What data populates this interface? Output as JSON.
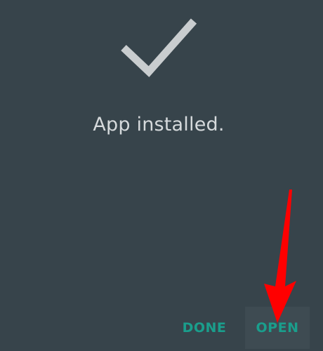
{
  "dialog": {
    "status_message": "App installed.",
    "done_label": "DONE",
    "open_label": "OPEN"
  },
  "icons": {
    "success": "checkmark-icon",
    "annotation": "red-arrow-icon"
  },
  "colors": {
    "background": "#37444b",
    "button_text": "#1a9e8c",
    "checkmark": "#c9cdcf",
    "annotation_arrow": "#ff0000"
  }
}
